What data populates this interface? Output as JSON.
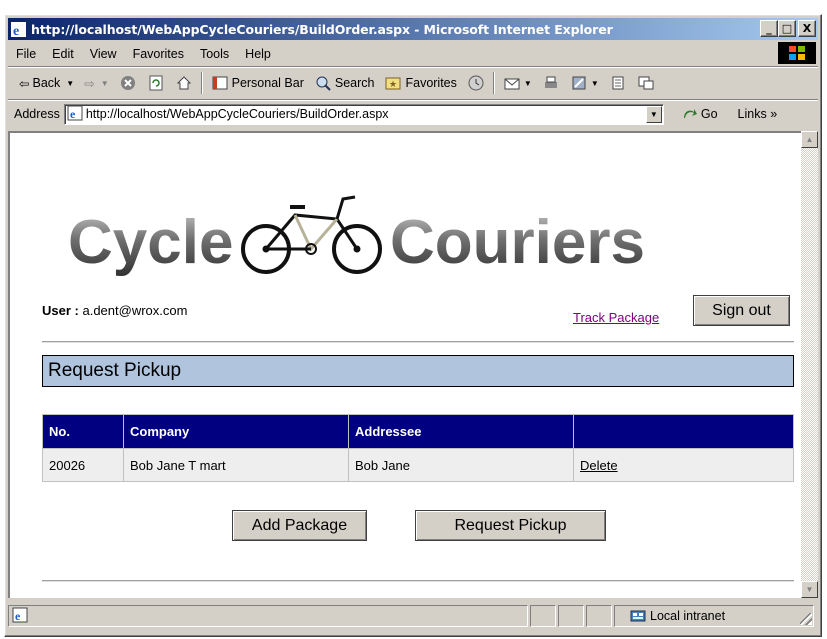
{
  "window": {
    "title": "http://localhost/WebAppCycleCouriers/BuildOrder.aspx - Microsoft Internet Explorer",
    "controls": {
      "minimize": "_",
      "maximize": "□",
      "close": "X"
    }
  },
  "menu": {
    "items": [
      {
        "label": "File"
      },
      {
        "label": "Edit"
      },
      {
        "label": "View"
      },
      {
        "label": "Favorites"
      },
      {
        "label": "Tools"
      },
      {
        "label": "Help"
      }
    ]
  },
  "toolbar": {
    "back": "Back",
    "personal_bar": "Personal Bar",
    "search": "Search",
    "favorites": "Favorites"
  },
  "address_bar": {
    "label": "Address",
    "url": "http://localhost/WebAppCycleCouriers/BuildOrder.aspx",
    "go": "Go",
    "links": "Links »"
  },
  "page": {
    "logo": {
      "left_word": "Cycle",
      "right_word": "Couriers"
    },
    "user_label": "User :",
    "user_value": "a.dent@wrox.com",
    "track_link": "Track Package",
    "signout_button": "Sign out",
    "heading": "Request Pickup",
    "table": {
      "columns": [
        "No.",
        "Company",
        "Addressee",
        ""
      ],
      "rows": [
        {
          "no": "20026",
          "company": "Bob Jane T mart",
          "addressee": "Bob Jane",
          "action": "Delete"
        }
      ]
    },
    "add_package_button": "Add Package",
    "request_pickup_button": "Request Pickup"
  },
  "status_bar": {
    "zone": "Local intranet"
  },
  "colors": {
    "title_gradient_start": "#0a246a",
    "heading_bg": "#b0c4de",
    "table_header_bg": "#000080",
    "visited_link": "#800080"
  }
}
